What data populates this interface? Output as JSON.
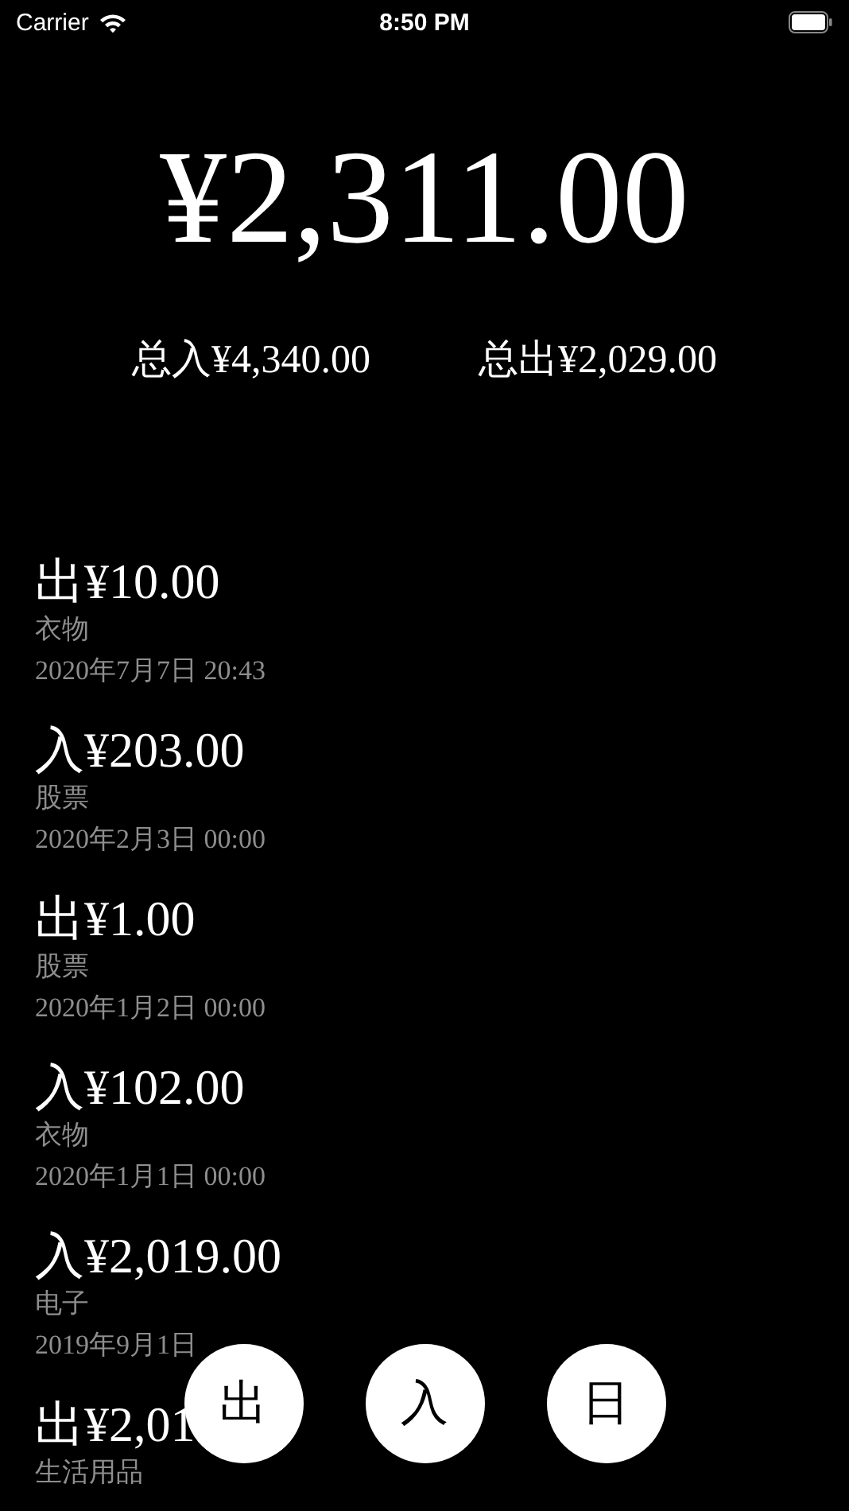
{
  "status_bar": {
    "carrier": "Carrier",
    "time": "8:50 PM"
  },
  "balance": "¥2,311.00",
  "totals": [
    {
      "label": "总入¥4,340.00"
    },
    {
      "label": "总出¥2,029.00"
    }
  ],
  "records": [
    {
      "amount": "出¥10.00",
      "category": "衣物",
      "date": "2020年7月7日 20:43"
    },
    {
      "amount": "入¥203.00",
      "category": "股票",
      "date": "2020年2月3日 00:00"
    },
    {
      "amount": "出¥1.00",
      "category": "股票",
      "date": "2020年1月2日 00:00"
    },
    {
      "amount": "入¥102.00",
      "category": "衣物",
      "date": "2020年1月1日 00:00"
    },
    {
      "amount": "入¥2,019.00",
      "category": "电子",
      "date": "2019年9月1日"
    },
    {
      "amount": "出¥2,01",
      "category": "生活用品"
    }
  ],
  "buttons": [
    {
      "label": "出"
    },
    {
      "label": "入"
    },
    {
      "label": "日"
    }
  ]
}
